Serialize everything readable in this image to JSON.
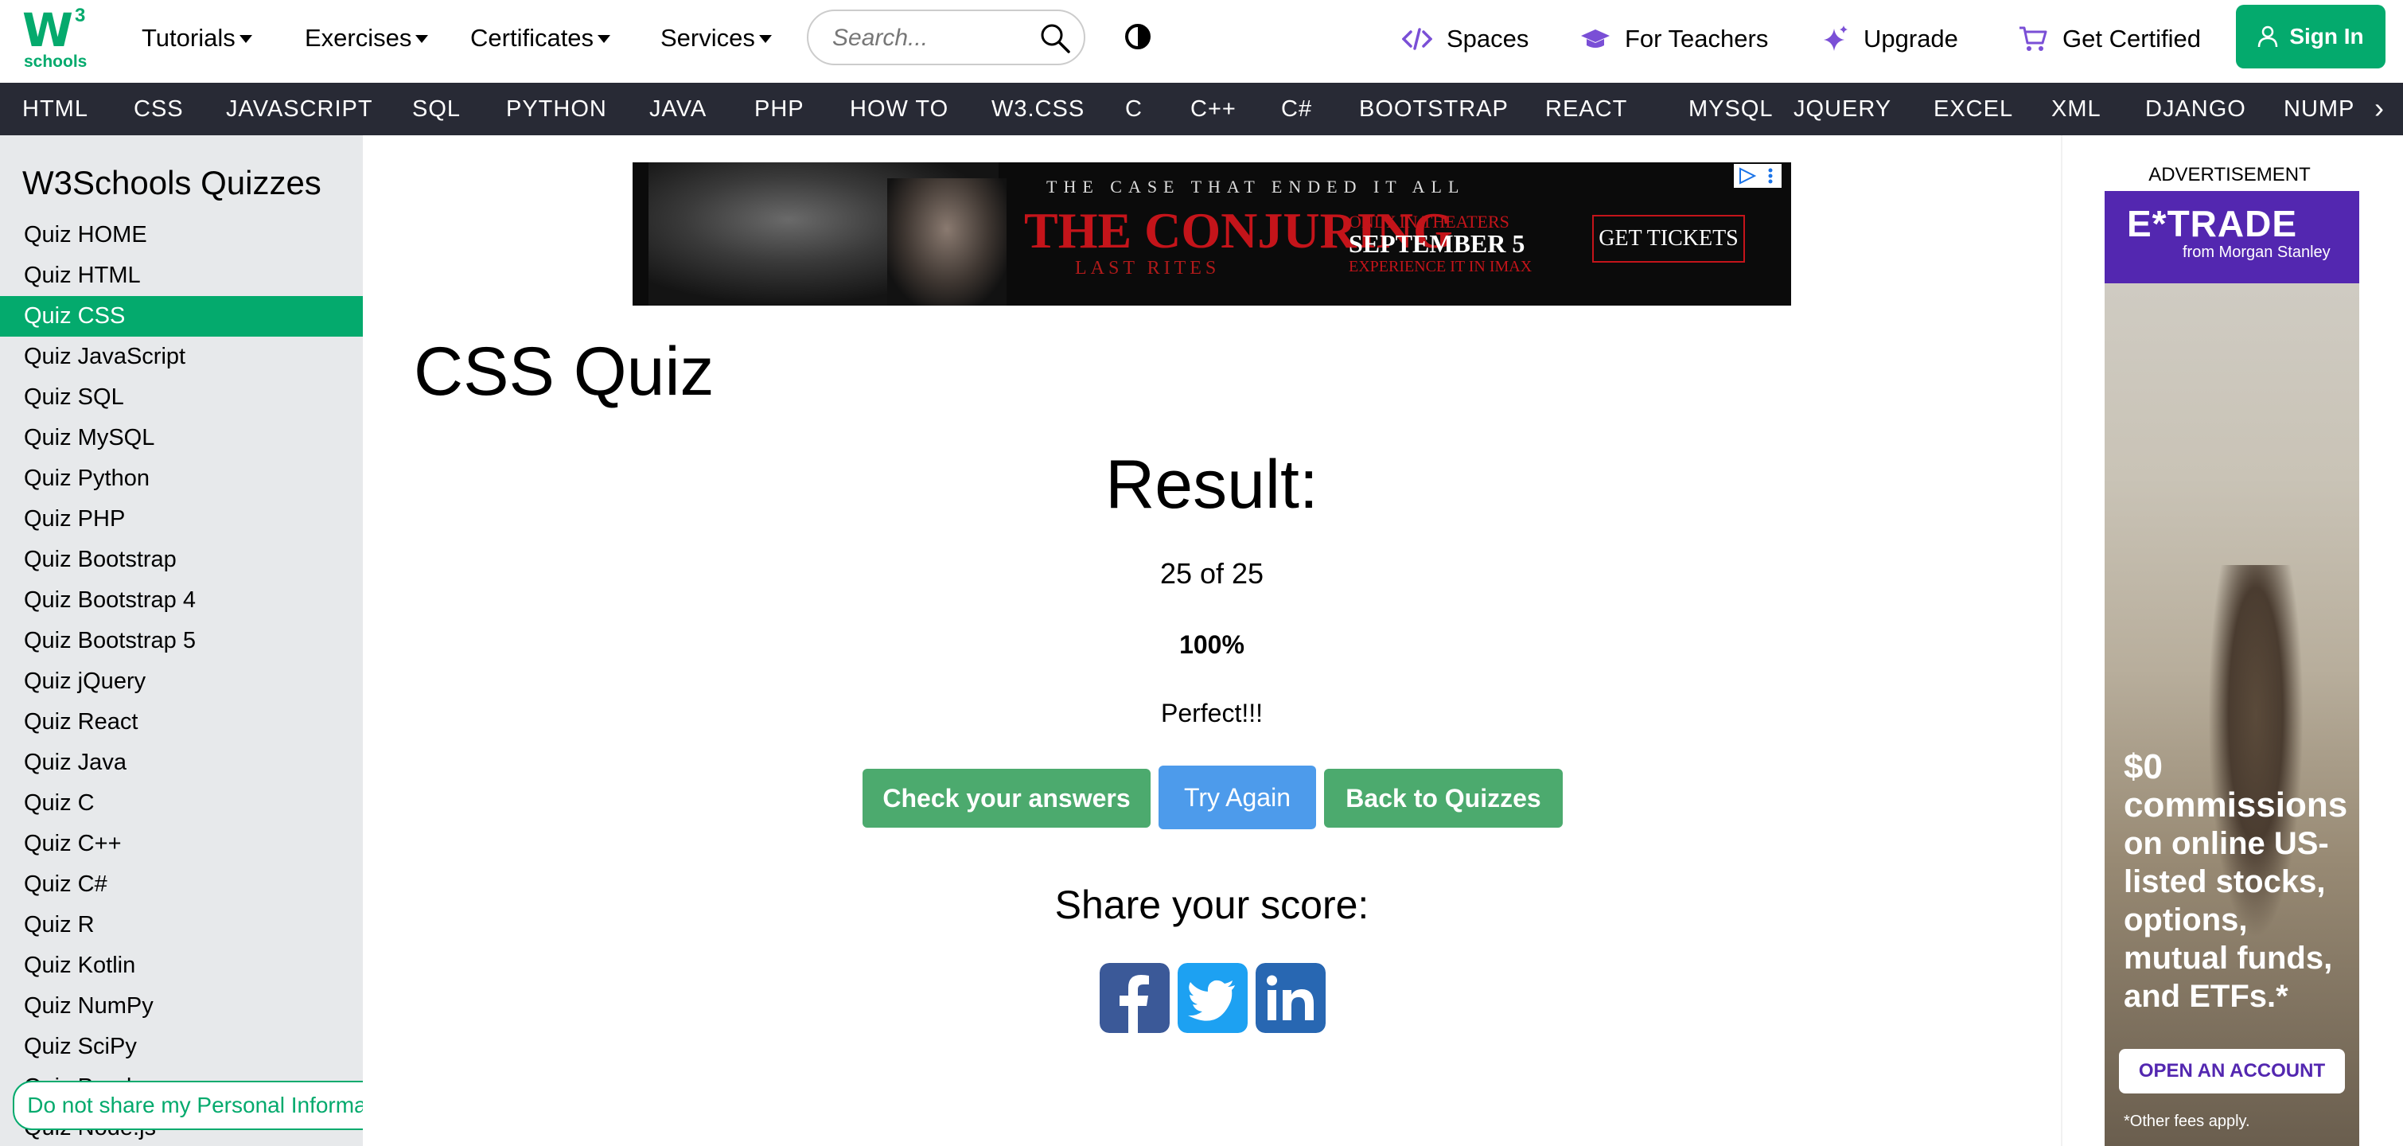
{
  "header": {
    "logo_mark": "W",
    "logo_sup": "3",
    "logo_text": "schools",
    "nav": [
      "Tutorials",
      "Exercises",
      "Certificates",
      "Services"
    ],
    "search_placeholder": "Search...",
    "links": [
      "Spaces",
      "For Teachers",
      "Upgrade",
      "Get Certified"
    ],
    "signin": "Sign In"
  },
  "langbar": [
    "HTML",
    "CSS",
    "JAVASCRIPT",
    "SQL",
    "PYTHON",
    "JAVA",
    "PHP",
    "HOW TO",
    "W3.CSS",
    "C",
    "C++",
    "C#",
    "BOOTSTRAP",
    "REACT",
    "MYSQL",
    "JQUERY",
    "EXCEL",
    "XML",
    "DJANGO",
    "NUMPY"
  ],
  "langbar_next": "›",
  "sidebar": {
    "title": "W3Schools Quizzes",
    "items": [
      "Quiz HOME",
      "Quiz HTML",
      "Quiz CSS",
      "Quiz JavaScript",
      "Quiz SQL",
      "Quiz MySQL",
      "Quiz Python",
      "Quiz PHP",
      "Quiz Bootstrap",
      "Quiz Bootstrap 4",
      "Quiz Bootstrap 5",
      "Quiz jQuery",
      "Quiz React",
      "Quiz Java",
      "Quiz C",
      "Quiz C++",
      "Quiz C#",
      "Quiz R",
      "Quiz Kotlin",
      "Quiz NumPy",
      "Quiz SciPy",
      "Quiz Pandas",
      "Quiz Node.js"
    ],
    "active_item": "Quiz CSS"
  },
  "privacy_link": "Do not share my Personal Information",
  "banner_ad": {
    "tagline": "THE CASE THAT ENDED IT ALL",
    "title": "THE CONJURING",
    "subtitle": "LAST RITES",
    "line1": "ONLY IN THEATERS",
    "line2": "SEPTEMBER 5",
    "line3": "EXPERIENCE IT IN IMAX",
    "cta": "GET TICKETS"
  },
  "main": {
    "title": "CSS Quiz",
    "result_heading": "Result:",
    "score": "25 of 25",
    "percent": "100%",
    "verdict": "Perfect!!!",
    "buttons": [
      "Check your answers",
      "Try Again",
      "Back to Quizzes"
    ],
    "share_heading": "Share your score:"
  },
  "side_ad": {
    "label": "ADVERTISEMENT",
    "brand": "E*TRADE",
    "brand_sub": "from Morgan Stanley",
    "copy_strong": "$0 commissions",
    "copy": "on online US-listed stocks, options, mutual funds, and ETFs.*",
    "cta": "OPEN AN ACCOUNT",
    "fine_print": "*Other fees apply."
  },
  "colors": {
    "brand_green": "#04AA6D",
    "langbar_bg": "#282A35",
    "sidebar_bg": "#E7E9EB",
    "btn_green": "#4CAA6E",
    "btn_blue": "#4D9BEB",
    "facebook": "#3B5998",
    "twitter": "#1DA1F2",
    "linkedin": "#2867B2",
    "etrade_purple": "#5327B0"
  }
}
